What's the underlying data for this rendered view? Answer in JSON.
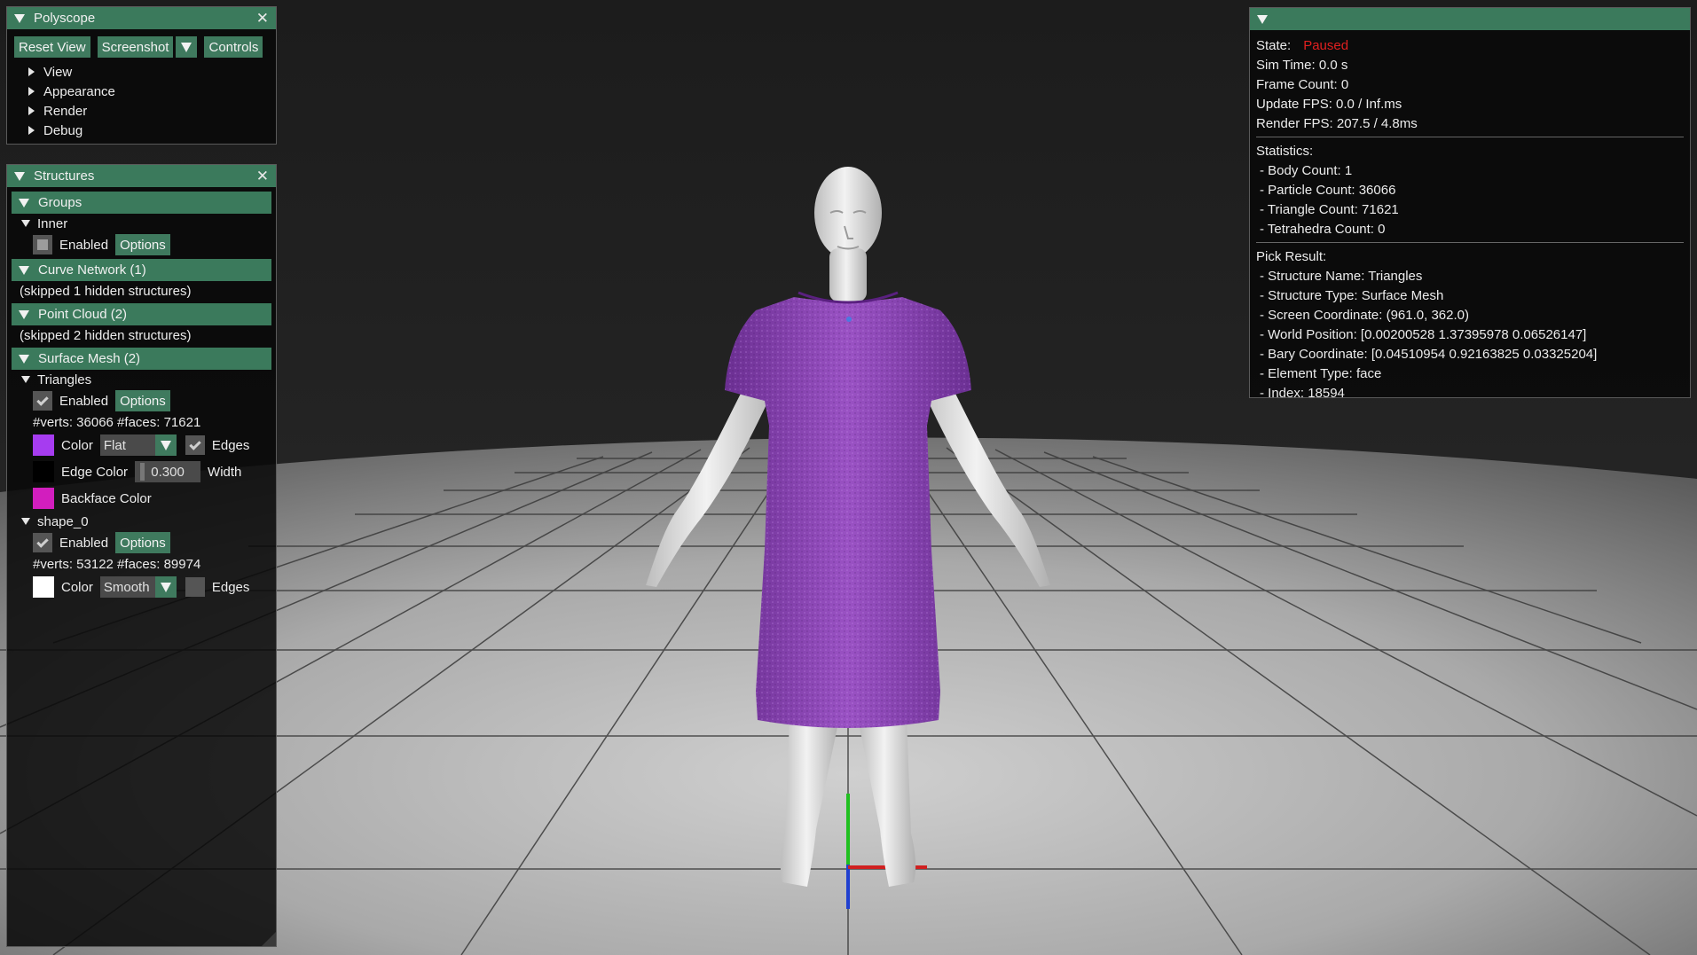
{
  "polyscope": {
    "title": "Polyscope",
    "buttons": {
      "reset_view": "Reset View",
      "screenshot": "Screenshot",
      "controls": "Controls"
    },
    "menu": [
      "View",
      "Appearance",
      "Render",
      "Debug"
    ]
  },
  "structures": {
    "title": "Structures",
    "groups": {
      "header": "Groups",
      "inner": {
        "label": "Inner",
        "enabled_label": "Enabled",
        "options_label": "Options"
      }
    },
    "curve_network": {
      "header": "Curve Network (1)",
      "skipped": "(skipped 1 hidden structures)"
    },
    "point_cloud": {
      "header": "Point Cloud (2)",
      "skipped": "(skipped 2 hidden structures)"
    },
    "surface_mesh": {
      "header": "Surface Mesh (2)",
      "triangles": {
        "label": "Triangles",
        "enabled_label": "Enabled",
        "options_label": "Options",
        "counts": "#verts: 36066  #faces: 71621",
        "color_label": "Color",
        "shading": "Flat",
        "edges_label": "Edges",
        "edge_color_label": "Edge Color",
        "edge_width": "0.300",
        "width_label": "Width",
        "backface_label": "Backface Color",
        "mesh_color": "#a63cf0",
        "edge_color": "#000000",
        "backface_color": "#d21ebe"
      },
      "shape_0": {
        "label": "shape_0",
        "enabled_label": "Enabled",
        "options_label": "Options",
        "counts": "#verts: 53122  #faces: 89974",
        "color_label": "Color",
        "shading": "Smooth",
        "edges_label": "Edges",
        "mesh_color": "#ffffff"
      }
    }
  },
  "info": {
    "state_label": "State:",
    "state_value": "Paused",
    "sim_time": "Sim Time: 0.0 s",
    "frame_count": "Frame Count: 0",
    "update_fps": "Update FPS: 0.0 / Inf.ms",
    "render_fps": "Render FPS: 207.5 / 4.8ms",
    "statistics_label": "Statistics:",
    "statistics": [
      "- Body Count: 1",
      "- Particle Count: 36066",
      "- Triangle Count: 71621",
      "- Tetrahedra Count: 0"
    ],
    "pick_label": "Pick Result:",
    "pick": [
      "- Structure Name: Triangles",
      "- Structure Type: Surface Mesh",
      "- Screen Coordinate: (961.0, 362.0)",
      "- World Position: [0.00200528 1.37395978 0.06526147]",
      "- Bary Coordinate: [0.04510954 0.92163825 0.03325204]",
      "- Element Type: face",
      "- Index: 18594"
    ]
  },
  "colors": {
    "header_green": "#3b7a5c",
    "paused_red": "#e02020",
    "dress_purple": "#8a44b2"
  }
}
